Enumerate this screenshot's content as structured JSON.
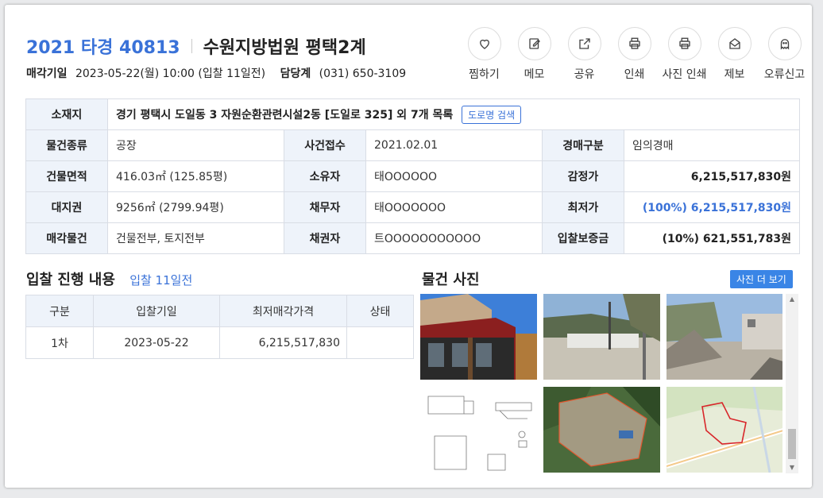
{
  "header": {
    "case_no": "2021 타경 40813",
    "court": "수원지방법원 평택2계",
    "sale_date_label": "매각기일",
    "sale_date_value": "2023-05-22(월) 10:00 (입찰 11일전)",
    "manager_label": "담당계",
    "manager_value": "(031) 650-3109"
  },
  "actions": [
    {
      "label": "찜하기",
      "icon": "heart-icon"
    },
    {
      "label": "메모",
      "icon": "edit-icon"
    },
    {
      "label": "공유",
      "icon": "share-icon"
    },
    {
      "label": "인쇄",
      "icon": "printer-icon"
    },
    {
      "label": "사진 인쇄",
      "icon": "printer-icon"
    },
    {
      "label": "제보",
      "icon": "mail-icon"
    },
    {
      "label": "오류신고",
      "icon": "ghost-icon"
    }
  ],
  "info": {
    "location_label": "소재지",
    "location_value": "경기 평택시 도일동 3 자원순환관련시설2동 [도일로 325] 외 7개 목록",
    "road_search": "도로명 검색",
    "rows": [
      {
        "k1": "물건종류",
        "v1": "공장",
        "k2": "사건접수",
        "v2": "2021.02.01",
        "k3": "경매구분",
        "v3": "임의경매"
      },
      {
        "k1": "건물면적",
        "v1": "416.03㎡ (125.85평)",
        "k2": "소유자",
        "v2": "태OOOOOO",
        "k3": "감정가",
        "v3": "6,215,517,830원"
      },
      {
        "k1": "대지권",
        "v1": "9256㎡ (2799.94평)",
        "k2": "채무자",
        "v2": "태OOOOOOO",
        "k3": "최저가",
        "v3": "(100%) 6,215,517,830원"
      },
      {
        "k1": "매각물건",
        "v1": "건물전부, 토지전부",
        "k2": "채권자",
        "v2": "트OOOOOOOOOOO",
        "k3": "입찰보증금",
        "v3": "(10%) 621,551,783원"
      }
    ]
  },
  "bid": {
    "title": "입찰 진행 내용",
    "subtitle": "입찰 11일전",
    "headers": [
      "구분",
      "입찰기일",
      "최저매각가격",
      "상태"
    ],
    "rows": [
      {
        "round": "1차",
        "date": "2023-05-22",
        "price": "6,215,517,830",
        "status": ""
      }
    ]
  },
  "photos": {
    "title": "물건 사진",
    "more_label": "사진 더 보기"
  },
  "colors": {
    "accent": "#3a72d8",
    "header_cell": "#eef3fa",
    "button": "#3a85e6"
  }
}
